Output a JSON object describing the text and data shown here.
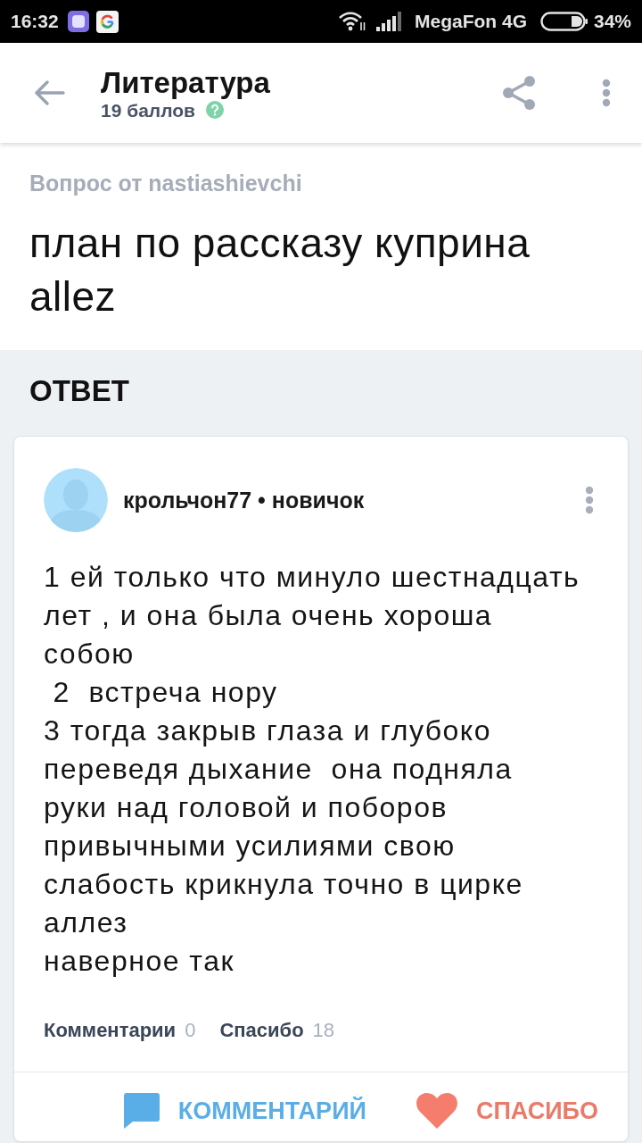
{
  "status_bar": {
    "time": "16:32",
    "carrier": "MegaFon 4G",
    "battery": "34%"
  },
  "app_bar": {
    "title": "Литература",
    "subtitle": "19 баллов"
  },
  "question": {
    "byline": "Вопрос от nastiashievchi",
    "text": "план по рассказу куприна allez"
  },
  "answers": {
    "heading": "ОТВЕТ",
    "items": [
      {
        "author": "крольчон77 • новичок",
        "text": "1 ей только что минуло шестнадцать лет , и она была очень хороша собою\n 2  встреча нору\n3 тогда закрыв глаза и глубоко переведя дыхание  она подняла руки над головой и поборов привычными усилиями свою слабость крикнула точно в цирке аллез\nнаверное так",
        "stats": [
          {
            "label": "Комментарии",
            "count": "0"
          },
          {
            "label": "Спасибо",
            "count": "18"
          }
        ],
        "actions": [
          {
            "kind": "comment",
            "label": "КОММЕНТАРИЙ"
          },
          {
            "kind": "thanks",
            "label": "СПАСИБО"
          }
        ]
      }
    ]
  }
}
